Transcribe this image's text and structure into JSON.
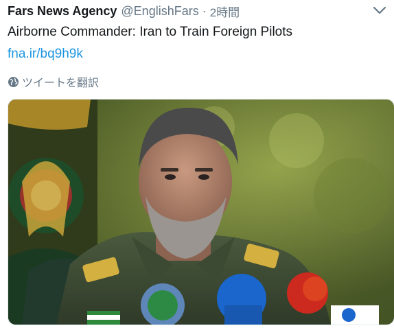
{
  "tweet": {
    "author_name": "Fars News Agency",
    "handle": "@EnglishFars",
    "separator": "·",
    "time": "2時間",
    "text": "Airborne Commander: Iran to Train Foreign Pilots",
    "link": "fna.ir/bq9h9k",
    "translate_label": "ツイートを翻訳",
    "icons": {
      "menu": "chevron-down-icon",
      "translate": "globe-icon"
    }
  },
  "colors": {
    "text": "#14171a",
    "secondary": "#657786",
    "link": "#1b95e0"
  }
}
